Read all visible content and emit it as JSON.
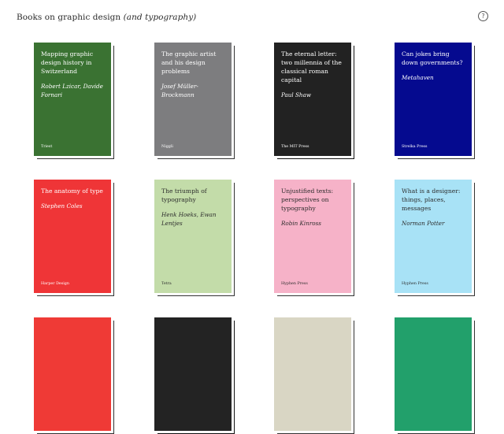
{
  "header": {
    "title_main": "Books on graphic design ",
    "title_italic": "(and typography)",
    "help_glyph": "?"
  },
  "books": [
    {
      "title": "Mapping graphic design history in Switzerland",
      "authors": "Robert Lzicar, Davide Fornari",
      "publisher": "Triest",
      "color": "#3a7232"
    },
    {
      "title": "The graphic artist and his design problems",
      "authors": "Josef Müller-Brockmann",
      "publisher": "Niggli",
      "color": "#7d7d7f"
    },
    {
      "title": "The eternal letter: two millennia of the classical roman capital",
      "authors": "Paul Shaw",
      "publisher": "The MIT Press",
      "color": "#222222"
    },
    {
      "title": "Can jokes bring down governments?",
      "authors": "Metahaven",
      "publisher": "Strelka Press",
      "color": "#050a8f"
    },
    {
      "title": "The anatomy of type",
      "authors": "Stephen Coles",
      "publisher": "Harper Design",
      "color": "#ef3537"
    },
    {
      "title": "The triumph of typography",
      "authors": "Henk Hoeks, Ewan Lentjes",
      "publisher": "Tetra",
      "color": "#c3dca9"
    },
    {
      "title": "Unjustified texts: perspectives on typography",
      "authors": "Robin Kinross",
      "publisher": "Hyphen Press",
      "color": "#f6b2c8"
    },
    {
      "title": "What is a designer: things, places, messages",
      "authors": "Norman Potter",
      "publisher": "Hyphen Press",
      "color": "#a8e2f6"
    },
    {
      "title": "",
      "authors": "",
      "publisher": "",
      "color": "#ef3a36"
    },
    {
      "title": "",
      "authors": "",
      "publisher": "",
      "color": "#232323"
    },
    {
      "title": "",
      "authors": "",
      "publisher": "",
      "color": "#d9d6c4"
    },
    {
      "title": "",
      "authors": "",
      "publisher": "",
      "color": "#22a06b"
    }
  ]
}
